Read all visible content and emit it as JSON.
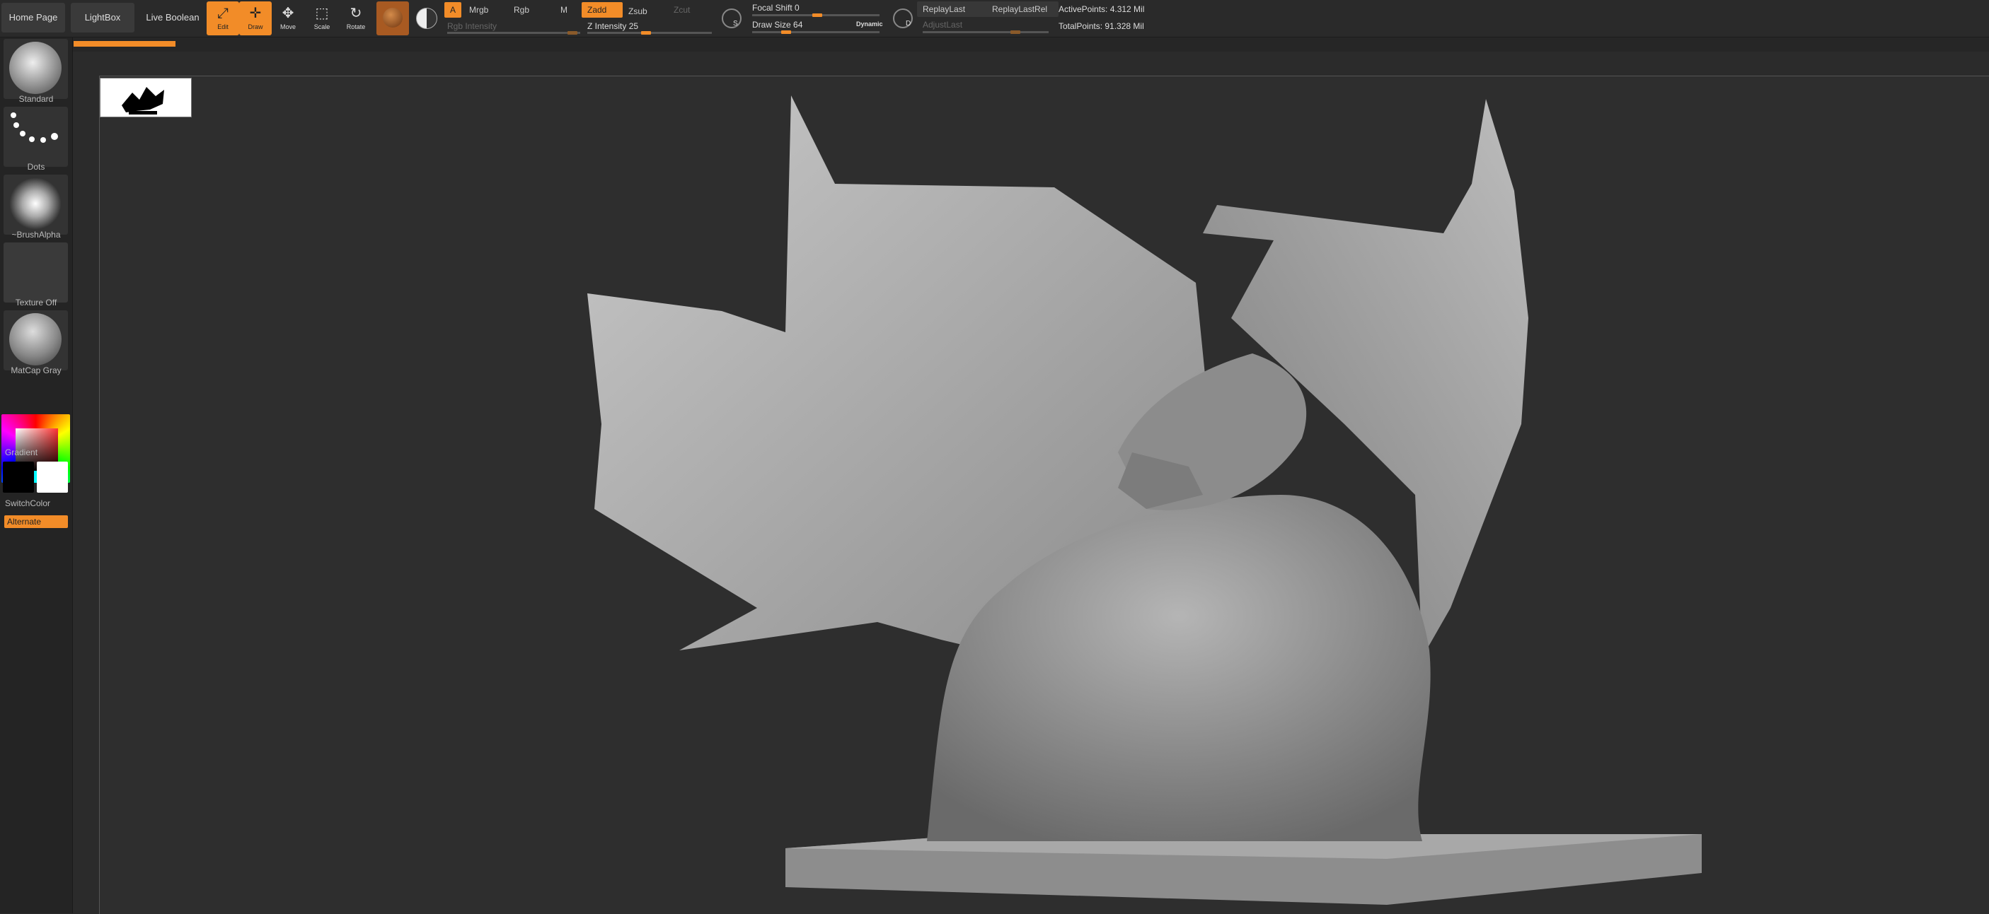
{
  "topnav": {
    "home": "Home Page",
    "lightbox": "LightBox",
    "live_boolean": "Live Boolean"
  },
  "tools": {
    "edit": "Edit",
    "draw": "Draw",
    "move": "Move",
    "scale": "Scale",
    "rotate": "Rotate"
  },
  "modes": {
    "a": "A",
    "mrgb": "Mrgb",
    "rgb": "Rgb",
    "m": "M",
    "zadd": "Zadd",
    "zsub": "Zsub",
    "zcut": "Zcut",
    "rgb_intensity": "Rgb Intensity",
    "z_intensity": "Z Intensity 25",
    "z_intensity_value": 25
  },
  "brush": {
    "focal_shift": "Focal Shift 0",
    "focal_shift_value": 0,
    "draw_size": "Draw Size 64",
    "draw_size_value": 64,
    "dynamic": "Dynamic",
    "s_label": "S",
    "d_label": "D"
  },
  "replay": {
    "replay_last": "ReplayLast",
    "replay_last_rel": "ReplayLastRel",
    "adjust_last": "AdjustLast"
  },
  "stats": {
    "active_points": "ActivePoints: 4.312 Mil",
    "total_points": "TotalPoints: 91.328 Mil"
  },
  "shelf": {
    "standard": "Standard",
    "dots": "Dots",
    "brush_alpha": "~BrushAlpha",
    "texture_off": "Texture Off",
    "matcap": "MatCap Gray",
    "gradient": "Gradient",
    "switch_color": "SwitchColor",
    "alternate": "Alternate"
  },
  "colors": {
    "accent": "#f28c28",
    "background": "#2b2b2b",
    "canvas": "#2e2e2e"
  }
}
